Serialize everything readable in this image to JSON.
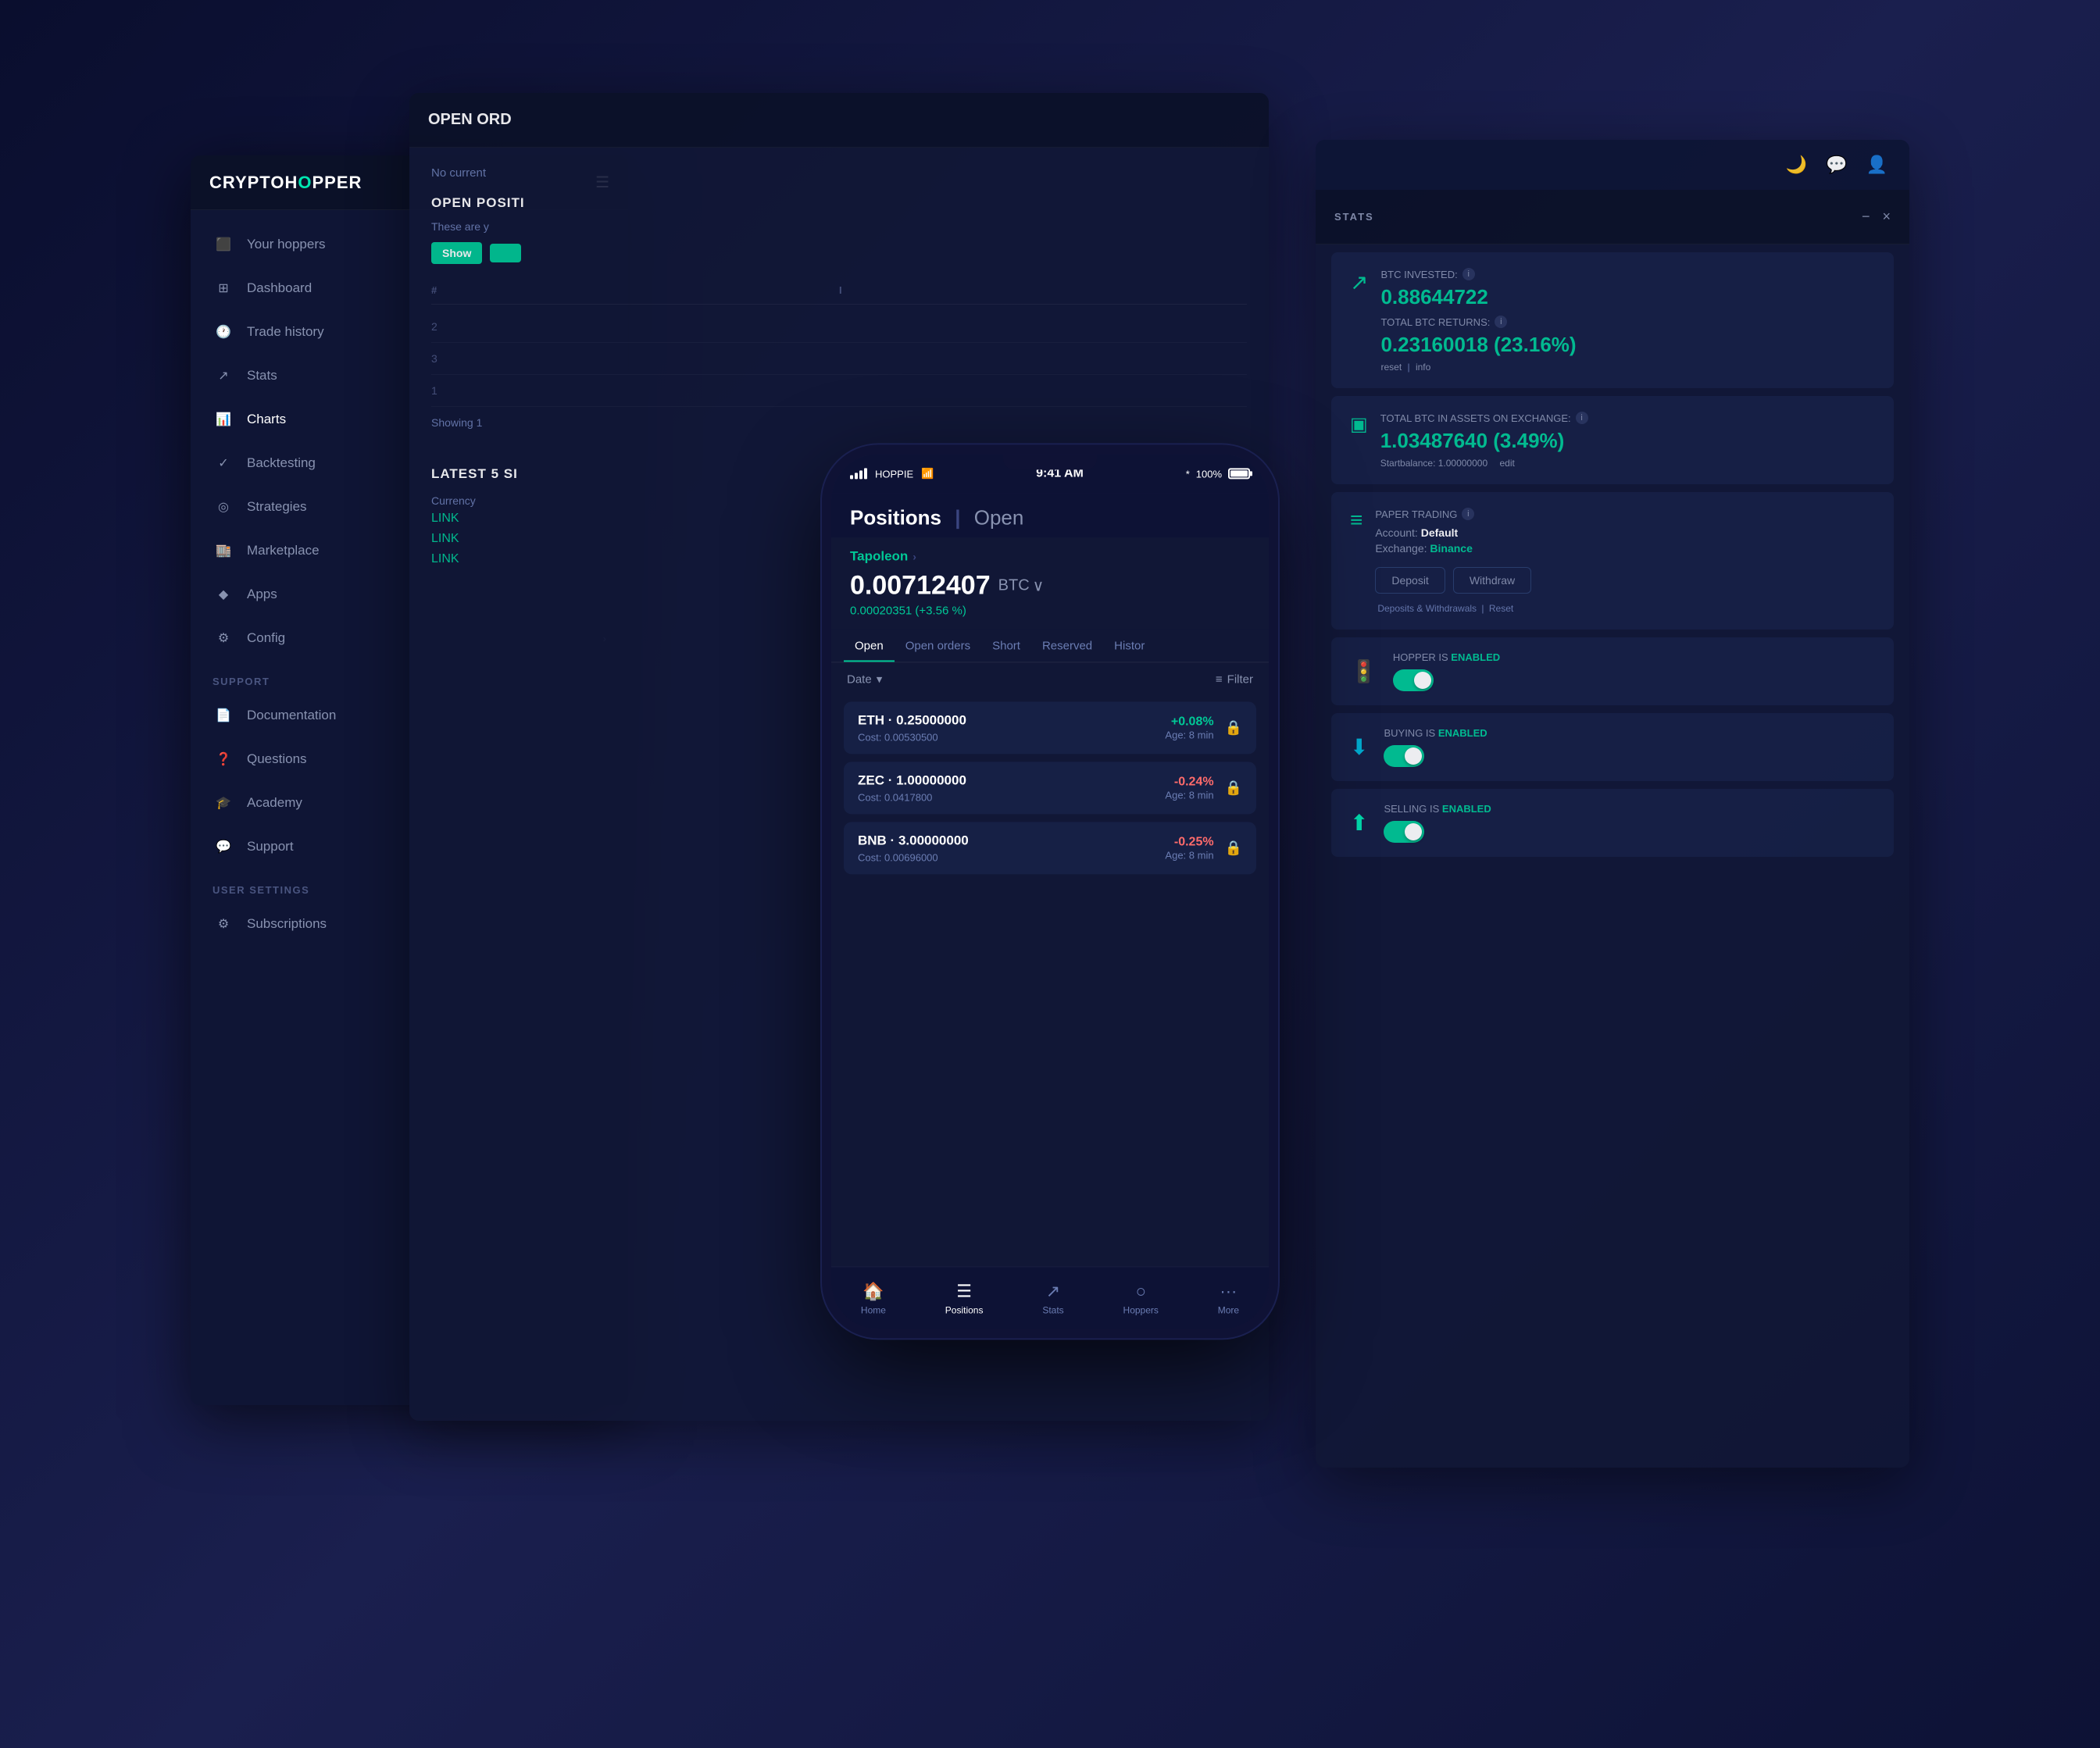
{
  "brand": {
    "name_part1": "CRYPTOH",
    "name_o": "O",
    "name_part2": "PPER"
  },
  "topbar": {
    "moon_icon": "🌙",
    "chat_icon": "💬",
    "user_icon": "👤"
  },
  "window_controls": {
    "minimize": "−",
    "close": "×"
  },
  "sidebar": {
    "items": [
      {
        "icon": "⬛",
        "label": "Your hoppers",
        "active": false
      },
      {
        "icon": "⊞",
        "label": "Dashboard",
        "active": false
      },
      {
        "icon": "🕐",
        "label": "Trade history",
        "active": false
      },
      {
        "icon": "📈",
        "label": "Stats",
        "active": false
      },
      {
        "icon": "📊",
        "label": "Charts",
        "active": true
      },
      {
        "icon": "✓",
        "label": "Backtesting",
        "active": false
      },
      {
        "icon": "◎",
        "label": "Strategies",
        "active": false
      },
      {
        "icon": "🏬",
        "label": "Marketplace",
        "active": false
      },
      {
        "icon": "⚙",
        "label": "Apps",
        "active": false
      },
      {
        "icon": "⚙",
        "label": "Config",
        "active": false,
        "has_chevron": true
      }
    ],
    "support_section": "SUPPORT",
    "support_items": [
      {
        "icon": "📄",
        "label": "Documentation"
      },
      {
        "icon": "❓",
        "label": "Questions"
      },
      {
        "icon": "🎓",
        "label": "Academy"
      },
      {
        "icon": "💬",
        "label": "Support"
      }
    ],
    "user_settings": "USER SETTINGS",
    "user_items": [
      {
        "icon": "⚙",
        "label": "Subscriptions"
      }
    ]
  },
  "main_panel": {
    "open_orders_title": "OPEN ORD",
    "no_current": "No current",
    "open_positions_title": "Open Positi",
    "these_are": "These are y",
    "show_btn_label": "Show",
    "table_rows": [
      "2",
      "3",
      "1"
    ],
    "showing_text": "Showing 1",
    "latest_signals_title": "LATEST 5 SI",
    "currency_label": "Currency",
    "links": [
      "LINK",
      "LINK",
      "LINK"
    ]
  },
  "stats_panel": {
    "title": "STATS",
    "btc_invested_label": "BTC INVESTED:",
    "btc_invested_value": "0.88644722",
    "total_btc_returns_label": "TOTAL BTC RETURNS:",
    "total_btc_returns_value": "0.23160018 (23.16%)",
    "reset_link": "reset",
    "info_link": "info",
    "total_assets_label": "TOTAL BTC IN ASSETS ON EXCHANGE:",
    "total_assets_value": "1.03487640 (3.49%)",
    "startbalance": "Startbalance: 1.00000000",
    "edit_link": "edit",
    "paper_trading_label": "PAPER TRADING",
    "account_label": "Account:",
    "account_value": "Default",
    "exchange_label": "Exchange:",
    "exchange_value": "Binance",
    "deposit_btn": "Deposit",
    "withdraw_btn": "Withdraw",
    "deposits_withdrawals": "Deposits & Withdrawals",
    "reset_link2": "Reset",
    "hopper_enabled_label": "HOPPER IS",
    "hopper_enabled_status": "ENABLED",
    "buying_enabled_label": "BUYING IS",
    "buying_enabled_status": "ENABLED",
    "selling_enabled_label": "SELLING IS",
    "selling_enabled_status": "ENABLED"
  },
  "phone": {
    "carrier": "HOPPIE",
    "wifi_icon": "📶",
    "time": "9:41 AM",
    "bluetooth_icon": "⚡",
    "battery_percent": "100%",
    "header_title": "Positions",
    "header_separator": "|",
    "header_open": "Open",
    "hopper_name": "Tapoleon",
    "btc_amount": "0.00712407",
    "btc_currency": "BTC",
    "btc_change": "0.00020351 (+3.56 %)",
    "tabs": [
      "Open",
      "Open orders",
      "Short",
      "Reserved",
      "Histor"
    ],
    "active_tab": "Open",
    "date_filter": "Date",
    "filter_label": "Filter",
    "positions": [
      {
        "name": "ETH · 0.25000000",
        "cost": "Cost: 0.00530500",
        "change": "+0.08%",
        "change_type": "positive",
        "age": "Age: 8 min"
      },
      {
        "name": "ZEC · 1.00000000",
        "cost": "Cost: 0.0417800",
        "change": "-0.24%",
        "change_type": "negative",
        "age": "Age: 8 min"
      },
      {
        "name": "BNB · 3.00000000",
        "cost": "Cost: 0.00696000",
        "change": "-0.25%",
        "change_type": "negative",
        "age": "Age: 8 min"
      }
    ],
    "bottom_nav": [
      {
        "icon": "🏠",
        "label": "Home",
        "active": false
      },
      {
        "icon": "📋",
        "label": "Positions",
        "active": true
      },
      {
        "icon": "📈",
        "label": "Stats",
        "active": false
      },
      {
        "icon": "○",
        "label": "Hoppers",
        "active": false
      },
      {
        "icon": "···",
        "label": "More",
        "active": false
      }
    ]
  }
}
